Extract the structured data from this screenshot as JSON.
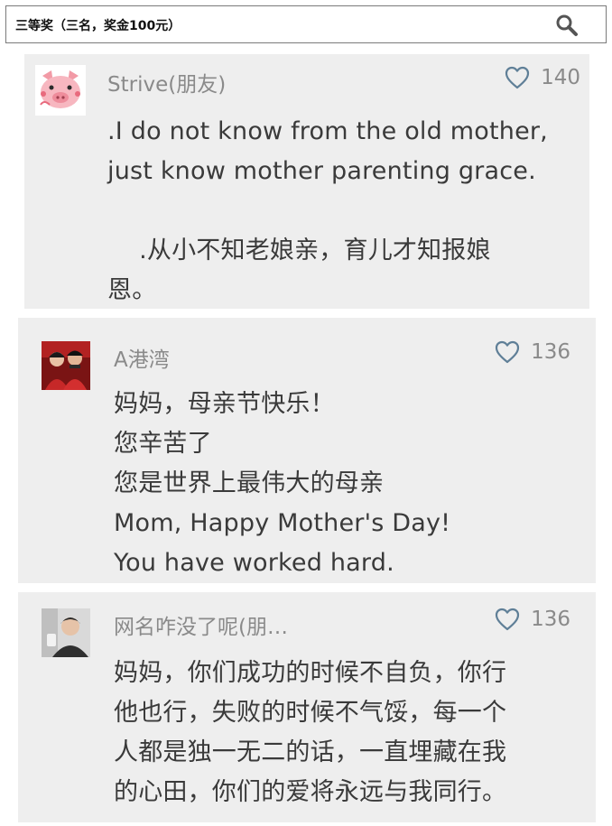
{
  "search": {
    "text": "三等奖（三名，奖金100元）"
  },
  "comments": [
    {
      "username": "Strive(朋友)",
      "likes": "140",
      "lines": [
        ".I do not know from the old mother,",
        "just know mother parenting grace.",
        "",
        "    .从小不知老娘亲，育儿才知报娘",
        "恩。"
      ]
    },
    {
      "username": "A港湾",
      "likes": "136",
      "lines": [
        "妈妈，母亲节快乐！",
        "您辛苦了",
        "您是世界上最伟大的母亲",
        "Mom, Happy Mother's Day!",
        "You have worked hard."
      ]
    },
    {
      "username": "网名咋没了呢(朋…",
      "likes": "136",
      "lines": [
        "妈妈，你们成功的时候不自负，你行",
        "他也行，失败的时候不气馁，每一个",
        "人都是独一无二的话，一直埋藏在我",
        "的心田，你们的爱将永远与我同行。"
      ]
    }
  ],
  "colors": {
    "card_background": "#eeeeee",
    "meta_text": "#8a8a8a",
    "comment_text": "#3a3a3a",
    "heart_outline": "#5f7f97"
  },
  "icons": {
    "search": "search-icon",
    "like": "heart-icon",
    "avatar_1": "pig-avatar",
    "avatar_2": "couple-photo-avatar",
    "avatar_3": "person-photo-avatar"
  }
}
